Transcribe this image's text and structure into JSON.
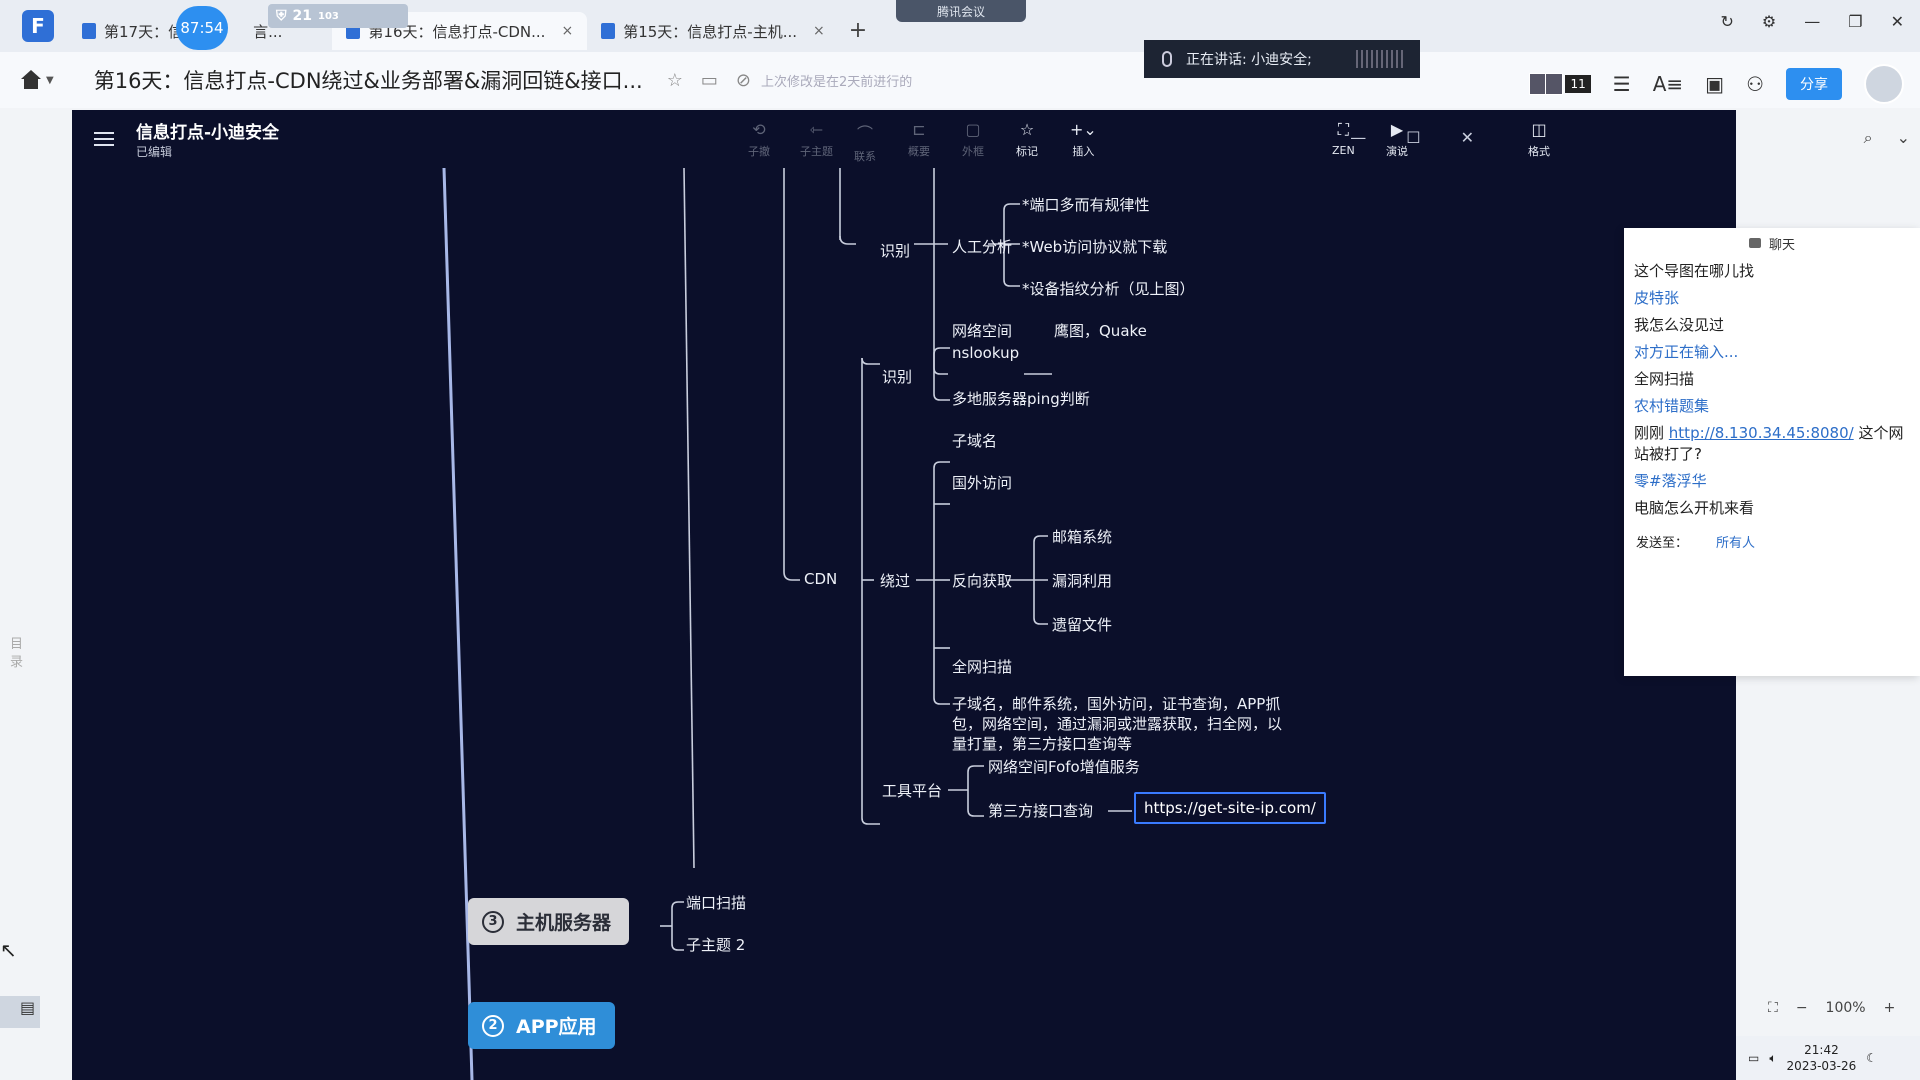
{
  "browser": {
    "tabs": [
      {
        "label": "第17天：信",
        "suffix": "言..."
      },
      {
        "label": "第16天：信息打点-CDN...",
        "close": "×"
      },
      {
        "label": "第15天：信息打点-主机...",
        "close": "×"
      }
    ],
    "timer": "87:54",
    "shield_text": "21",
    "shield_sub": "103",
    "meeting_label": "腾讯会议",
    "new_tab": "+"
  },
  "titlebar": {
    "doc_title": "第16天：信息打点-CDN绕过&业务部署&漏洞回链&接口...",
    "save_status": "上次修改是在2天前进行的",
    "speaking": "正在讲话: 小迪安全;",
    "avatar_count": "11",
    "share_label": "分享"
  },
  "left_rail": {
    "toc_label": "目录"
  },
  "mindmap": {
    "title": "信息打点-小迪安全",
    "subtitle": "已编辑",
    "toolbar": {
      "undo": "子撤",
      "redo": "子主题",
      "relation": "联系",
      "summary": "概要",
      "outline": "外框",
      "mark": "标记",
      "insert": "插入",
      "zen": "ZEN",
      "present": "演说",
      "format": "格式"
    },
    "nodes": {
      "identify1": "识别",
      "manual": "人工分析",
      "port": "*端口多而有规律性",
      "web": "*Web访问协议就下载",
      "finger": "*设备指纹分析（见上图）",
      "cyberspace": "网络空间",
      "eagle": "鹰图，Quake",
      "identify2": "识别",
      "nslookup": "nslookup",
      "ping": "多地服务器ping判断",
      "cdn": "CDN",
      "bypass": "绕过",
      "subdomain": "子域名",
      "foreign": "国外访问",
      "reverse": "反向获取",
      "mail": "邮箱系统",
      "vuln": "漏洞利用",
      "leftover": "遗留文件",
      "fullscan": "全网扫描",
      "summary_text": "子域名，邮件系统，国外访问，证书查询，APP抓包，网络空间，通过漏洞或泄露获取，扫全网，以量打量，第三方接口查询等",
      "tools": "工具平台",
      "fofa": "网络空间Fofo增值服务",
      "thirdparty": "第三方接口查询",
      "url": "https://get-site-ip.com/",
      "host_num": "3",
      "host": "主机服务器",
      "portscan": "端口扫描",
      "subtopic2": "子主题 2",
      "app_num": "2",
      "app": "APP应用"
    }
  },
  "chat": {
    "header": "聊天",
    "messages": [
      {
        "text": "这个导图在哪儿找",
        "type": "msg"
      },
      {
        "text": "皮特张",
        "type": "name"
      },
      {
        "text": "我怎么没见过",
        "type": "msg"
      },
      {
        "text": "对方正在输入...",
        "type": "name"
      },
      {
        "text": "全网扫描",
        "type": "msg"
      },
      {
        "text": "农村错题集",
        "type": "name"
      },
      {
        "text": "刚刚",
        "type": "msg-link",
        "link": "http://8.130.34.45:8080/",
        "after": " 这个网站被打了?"
      },
      {
        "text": "零#落浮华",
        "type": "name"
      },
      {
        "text": "电脑怎么开机来看",
        "type": "msg"
      }
    ],
    "send_to_label": "发送至：",
    "send_to_value": "所有人"
  },
  "zoom": {
    "minus": "−",
    "level": "100%",
    "plus": "+"
  },
  "clock": {
    "time": "21:42",
    "date": "2023-03-26"
  }
}
